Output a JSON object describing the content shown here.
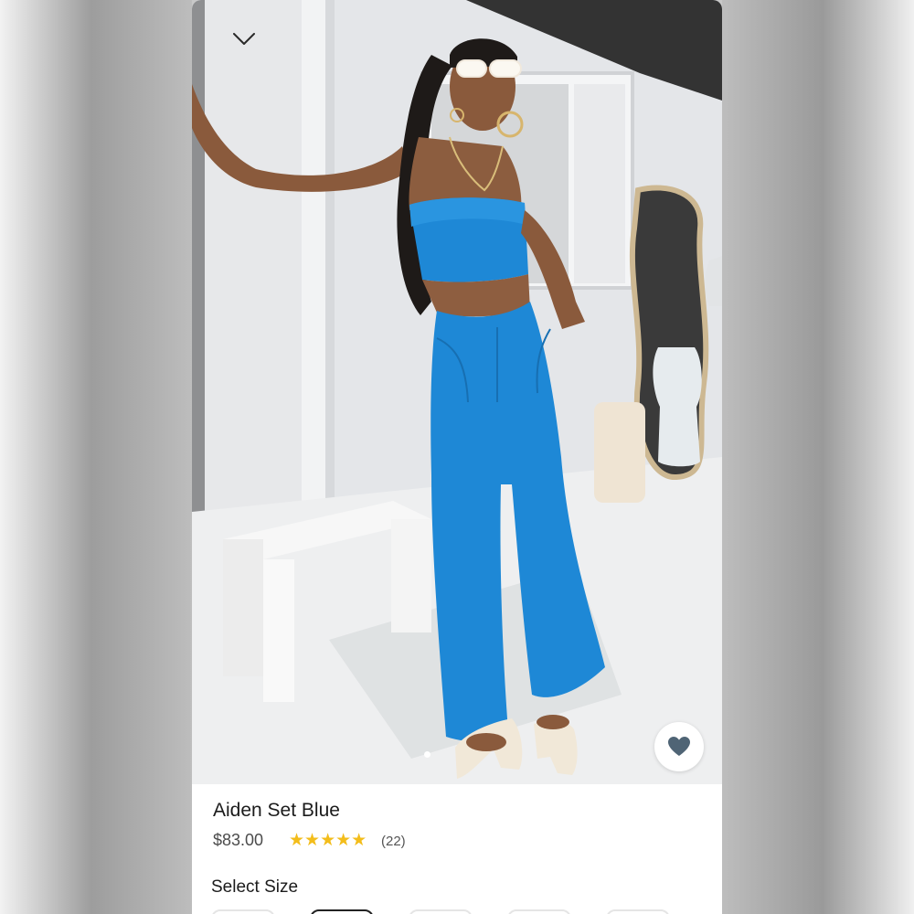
{
  "product": {
    "name": "Aiden Set Blue",
    "price": "$83.00",
    "rating_stars": "★★★★★",
    "rating": 5,
    "review_count": "(22)"
  },
  "sizes": {
    "label": "Select Size"
  },
  "icons": {
    "collapse": "chevron-down-icon",
    "favorite": "heart-icon"
  },
  "gallery": {
    "current_image": 1
  },
  "colors": {
    "star": "#f3bd1b",
    "heart": "#4f6475",
    "outfit": "#1e88d6"
  }
}
